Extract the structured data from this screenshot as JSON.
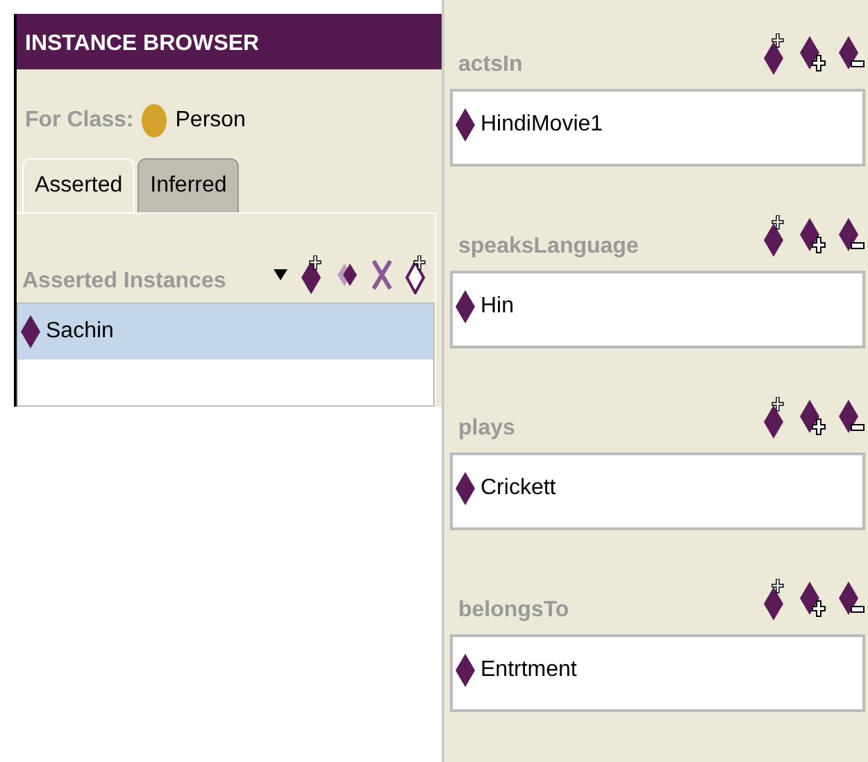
{
  "panel": {
    "title": "INSTANCE BROWSER",
    "class_label": "For Class:",
    "class_name": "Person",
    "tabs": [
      {
        "label": "Asserted",
        "selected": true
      },
      {
        "label": "Inferred",
        "selected": false
      }
    ],
    "list_title": "Asserted Instances",
    "instances": [
      {
        "name": "Sachin",
        "selected": true
      }
    ]
  },
  "properties": [
    {
      "name": "actsIn",
      "values": [
        "HindiMovie1"
      ]
    },
    {
      "name": "speaksLanguage",
      "values": [
        "Hin"
      ]
    },
    {
      "name": "plays",
      "values": [
        "Crickett"
      ]
    },
    {
      "name": "belongsTo",
      "values": [
        "Entrtment"
      ]
    }
  ]
}
